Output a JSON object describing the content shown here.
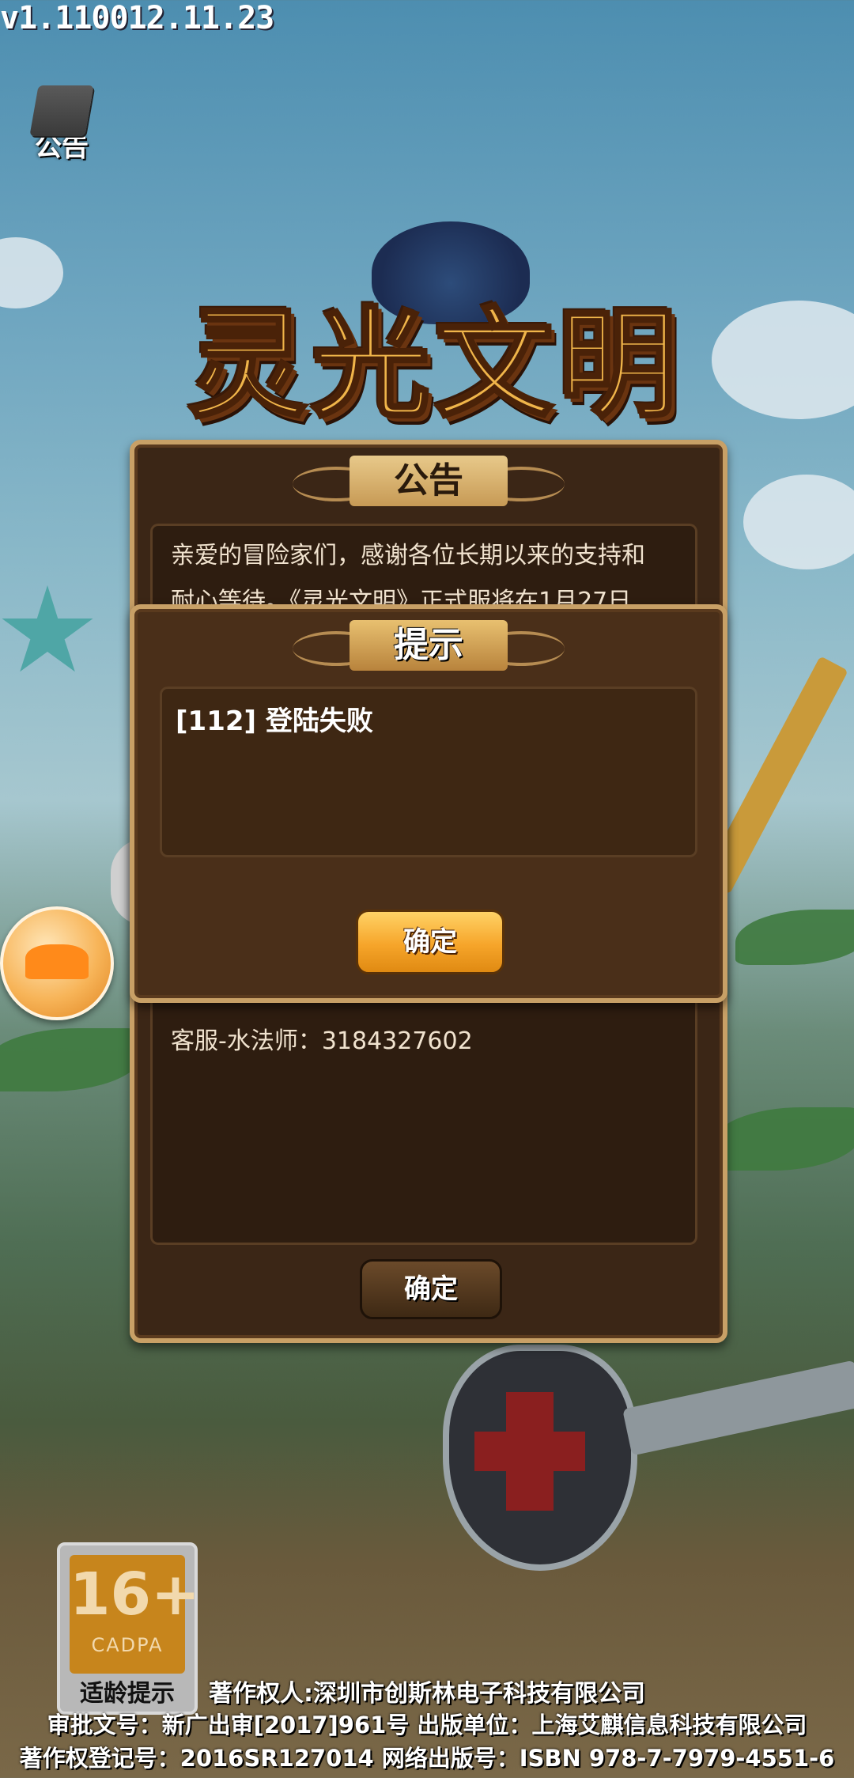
{
  "version": "v1.110012.11.23",
  "notice_button": {
    "label": "公告",
    "icon": "quill-book-icon"
  },
  "logo": {
    "text": "灵光文明"
  },
  "announcement": {
    "title": "公告",
    "body_line1": "亲爱的冒险家们，感谢各位长期以来的支持和",
    "body_line2": "耐心等待。《灵光文明》正式服将在1月27日",
    "contact": "客服-水法师：3184327602",
    "confirm_label": "确定"
  },
  "dialog": {
    "title": "提示",
    "message": "[112] 登陆失败",
    "confirm_label": "确定"
  },
  "age_badge": {
    "rating": "16+",
    "org": "CADPA",
    "label": "适龄提示"
  },
  "footer": {
    "line1": "著作权人:深圳市创斯林电子科技有限公司",
    "line2": "审批文号：新广出审[2017]961号 出版单位：上海艾麒信息科技有限公司",
    "line3": "著作权登记号：2016SR127014  网络出版号：ISBN 978-7-7979-4551-6"
  }
}
